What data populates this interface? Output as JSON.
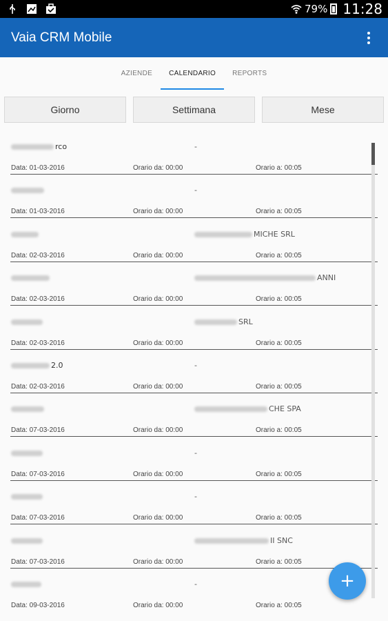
{
  "status": {
    "battery_pct": "79%",
    "time": "11:28"
  },
  "app": {
    "title": "Vaia CRM Mobile",
    "menu_icon": "more-vert-icon"
  },
  "tabs": [
    {
      "label": "AZIENDE",
      "active": false
    },
    {
      "label": "CALENDARIO",
      "active": true
    },
    {
      "label": "REPORTS",
      "active": false
    }
  ],
  "view_toggles": [
    "Giorno",
    "Settimana",
    "Mese"
  ],
  "entries": [
    {
      "name_suffix": "rco",
      "company": "-",
      "company_suffix": "",
      "date": "Data: 01-03-2016",
      "from": "Orario da: 00:00",
      "to": "Orario a: 00:05"
    },
    {
      "name_suffix": "",
      "company": "-",
      "company_suffix": "",
      "date": "Data: 01-03-2016",
      "from": "Orario da: 00:00",
      "to": "Orario a: 00:05"
    },
    {
      "name_suffix": "",
      "company": "",
      "company_suffix": "MICHE SRL",
      "date": "Data: 02-03-2016",
      "from": "Orario da: 00:00",
      "to": "Orario a: 00:05"
    },
    {
      "name_suffix": "",
      "company": "",
      "company_suffix": "ANNI",
      "date": "Data: 02-03-2016",
      "from": "Orario da: 00:00",
      "to": "Orario a: 00:05"
    },
    {
      "name_suffix": "",
      "company": "",
      "company_suffix": "SRL",
      "date": "Data: 02-03-2016",
      "from": "Orario da: 00:00",
      "to": "Orario a: 00:05"
    },
    {
      "name_suffix": "2.0",
      "company": "-",
      "company_suffix": "",
      "date": "Data: 02-03-2016",
      "from": "Orario da: 00:00",
      "to": "Orario a: 00:05"
    },
    {
      "name_suffix": "",
      "company": "",
      "company_suffix": "CHE SPA",
      "date": "Data: 07-03-2016",
      "from": "Orario da: 00:00",
      "to": "Orario a: 00:05"
    },
    {
      "name_suffix": "",
      "company": "-",
      "company_suffix": "",
      "date": "Data: 07-03-2016",
      "from": "Orario da: 00:00",
      "to": "Orario a: 00:05"
    },
    {
      "name_suffix": "",
      "company": "-",
      "company_suffix": "",
      "date": "Data: 07-03-2016",
      "from": "Orario da: 00:00",
      "to": "Orario a: 00:05"
    },
    {
      "name_suffix": "",
      "company": "",
      "company_suffix": "II SNC",
      "date": "Data: 07-03-2016",
      "from": "Orario da: 00:00",
      "to": "Orario a: 00:05"
    },
    {
      "name_suffix": "",
      "company": "-",
      "company_suffix": "",
      "date": "Data: 09-03-2016",
      "from": "Orario da: 00:00",
      "to": "Orario a: 00:05"
    }
  ],
  "fab": {
    "label": "+",
    "icon": "add-icon",
    "color": "#3d9be9"
  },
  "colors": {
    "appbar": "#1565b8",
    "tab_indicator": "#1e88e5"
  }
}
